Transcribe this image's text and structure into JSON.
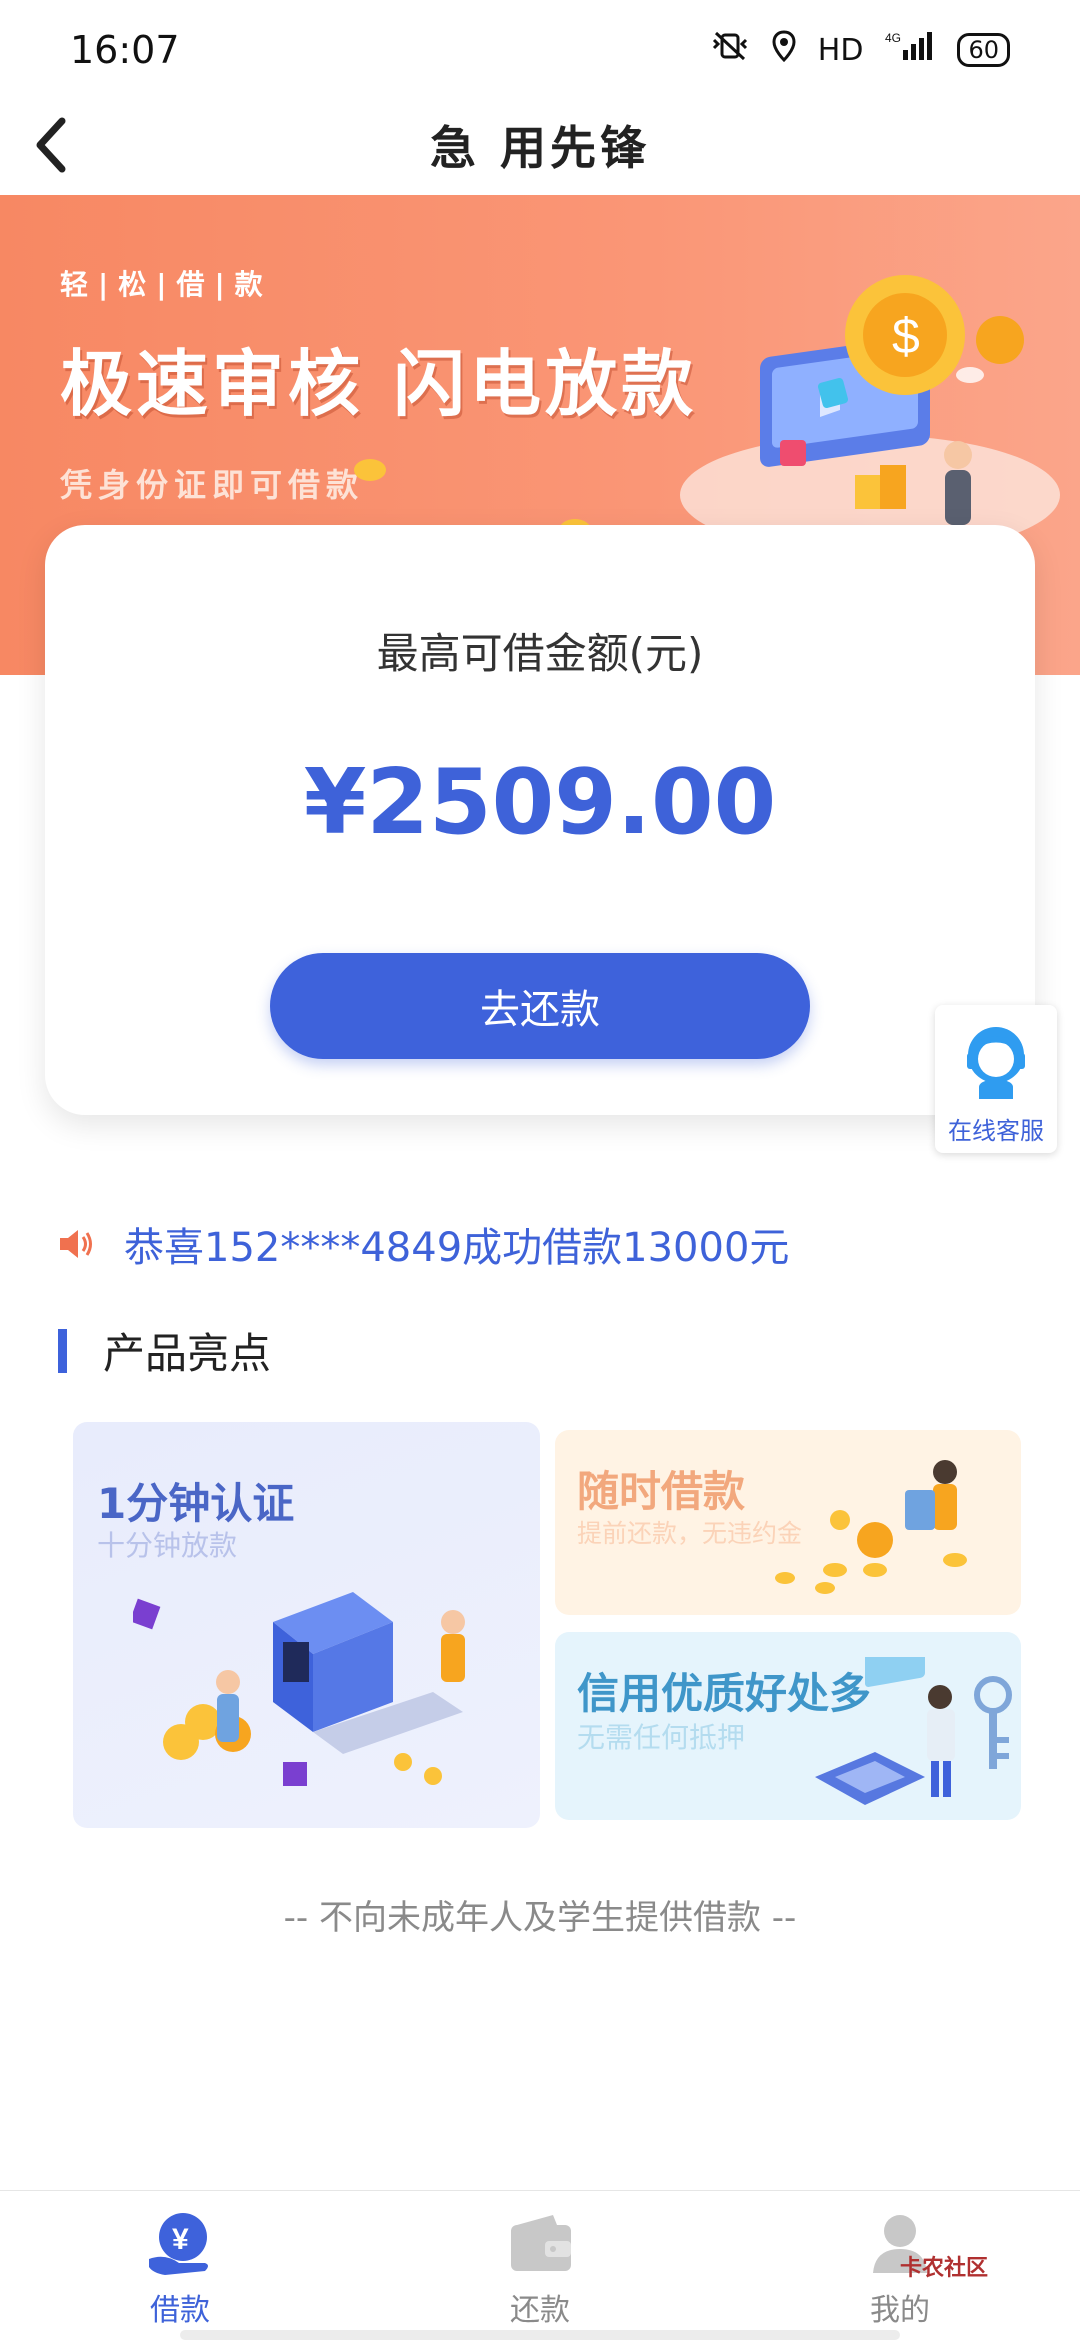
{
  "status_bar": {
    "time": "16:07",
    "hd": "HD",
    "network": "4G",
    "battery": "60"
  },
  "nav": {
    "title": "急 用先锋"
  },
  "banner": {
    "tagline": "轻|松|借|款",
    "headline": "极速审核 闪电放款",
    "subtitle": "凭身份证即可借款"
  },
  "card": {
    "label": "最高可借金额(元)",
    "amount": "¥2509.00",
    "button": "去还款"
  },
  "service": {
    "label": "在线客服"
  },
  "notice": {
    "text": "恭喜152****4849成功借款13000元"
  },
  "section": {
    "title": "产品亮点"
  },
  "features": [
    {
      "title": "1分钟认证",
      "subtitle": "十分钟放款"
    },
    {
      "title": "随时借款",
      "subtitle": "提前还款，无违约金"
    },
    {
      "title": "信用优质好处多",
      "subtitle": "无需任何抵押"
    }
  ],
  "footer_note": "-- 不向未成年人及学生提供借款 --",
  "tabs": [
    {
      "label": "借款",
      "icon": "yen-hand-icon",
      "active": true
    },
    {
      "label": "还款",
      "icon": "wallet-icon",
      "active": false
    },
    {
      "label": "我的",
      "icon": "user-icon",
      "active": false
    }
  ],
  "watermark": "卡农社区",
  "colors": {
    "primary": "#3e62db",
    "banner": "#f78863",
    "notice_icon": "#f0714f"
  }
}
